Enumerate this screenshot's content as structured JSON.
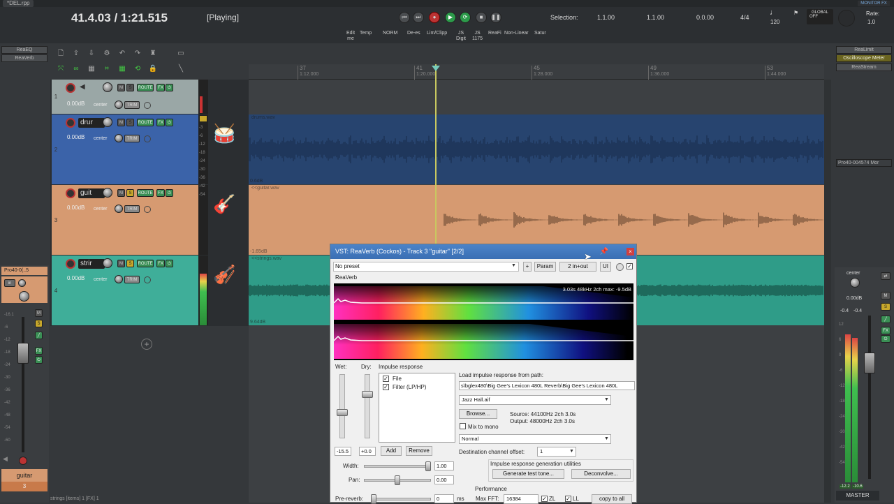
{
  "window": {
    "file_tab": "*DEL.rpp",
    "monitor_badge": "MONITOR FX"
  },
  "transport": {
    "time": "41.4.03 / 1:21.515",
    "state": "[Playing]",
    "selection_label": "Selection:",
    "selection_start": "1.1.00",
    "selection_end": "1.1.00",
    "selection_len": "0.0.00",
    "time_sig": "4/4",
    "bpm": "120",
    "global_label": "GLOBAL",
    "global_state": "OFF",
    "rate_label": "Rate:",
    "rate_value": "1.0",
    "sub_buttons": [
      {
        "l1": "Edit",
        "l2": "me"
      },
      {
        "l1": "Temp",
        "l2": ""
      },
      {
        "l1": "NORM",
        "l2": ""
      },
      {
        "l1": "De-es",
        "l2": ""
      },
      {
        "l1": "Lim/Clipp",
        "l2": ""
      },
      {
        "l1": "JS",
        "l2": "Digit"
      },
      {
        "l1": "JS",
        "l2": "1175"
      },
      {
        "l1": "ReaFi",
        "l2": ""
      },
      {
        "l1": "Non-Linear",
        "l2": ""
      },
      {
        "l1": "Satur",
        "l2": ""
      }
    ]
  },
  "left_fx": [
    "ReaEQ",
    "ReaVerb"
  ],
  "right_fx": [
    "ReaLimit",
    "Oscilloscope Meter",
    "ReaStream"
  ],
  "right_plugin": "Pro40-004574 Mor",
  "ruler": [
    {
      "bar": "37",
      "time": "1:12.000"
    },
    {
      "bar": "41",
      "time": "1:20.000"
    },
    {
      "bar": "45",
      "time": "1:28.000"
    },
    {
      "bar": "49",
      "time": "1:36.000"
    },
    {
      "bar": "53",
      "time": "1:44.000"
    }
  ],
  "tracks": [
    {
      "num": "1",
      "name": "",
      "vol": "0.00dB",
      "pan": "center",
      "color": "#9aa7a6",
      "in": "in"
    },
    {
      "num": "2",
      "name": "drur",
      "vol": "0.00dB",
      "pan": "center",
      "color": "#3b63a9",
      "clip": "drums.wav",
      "clip_db": "0.6dB"
    },
    {
      "num": "3",
      "name": "guit",
      "vol": "0.00dB",
      "pan": "center",
      "color": "#d69a71",
      "clip": "<<guitar.wav",
      "clip_db": "-1.65dB"
    },
    {
      "num": "4",
      "name": "strir",
      "vol": "0.00dB",
      "pan": "center",
      "color": "#3fae99",
      "clip": "<<strings.wav",
      "clip_db": "9.64dB"
    }
  ],
  "track_buttons": {
    "m": "M",
    "s": "S",
    "route": "ROUTE",
    "fx": "FX",
    "trim": "TRIM"
  },
  "meter_scale": [
    "-3",
    "-6",
    "-12",
    "-18",
    "-24",
    "-30",
    "-36",
    "-42",
    "-54"
  ],
  "mixer_left": {
    "plugin": "Pro40-0(..5",
    "track_name": "guitar",
    "track_num": "3",
    "scale": [
      "-16.1",
      "-6",
      "-12",
      "-18",
      "-24",
      "-30",
      "-36",
      "-42",
      "-48",
      "-54",
      "-60"
    ]
  },
  "mixer_right": {
    "pan": "center",
    "vol": "0.00dB",
    "peak_l": "-0.4",
    "peak_r": "-0.4",
    "clip_l": "-12.2",
    "clip_r": "-10.6",
    "label": "MASTER",
    "scale": [
      "12",
      "6",
      "0",
      "-6",
      "-12",
      "-18",
      "-24",
      "-30",
      "-42",
      "-54"
    ]
  },
  "statusbar": "strings [items] 1 [FX] 1",
  "reaverb": {
    "title": "VST: ReaVerb (Cockos) - Track 3 \"guitar\" [2/2]",
    "preset": "No preset",
    "plus": "+",
    "param": "Param",
    "io": "2 in+out",
    "ui": "UI",
    "plugin_name": "ReaVerb",
    "spectrum_info": "3.03s 48kHz 2ch max: -9.5dB",
    "wet_label": "Wet:",
    "dry_label": "Dry:",
    "ir_label": "Impulse response",
    "ir_items": [
      {
        "label": "File",
        "checked": true
      },
      {
        "label": "Filter (LP/HP)",
        "checked": true
      }
    ],
    "wet_value": "-15.5",
    "dry_value": "+0.0",
    "add": "Add",
    "remove": "Remove",
    "load_label": "Load impulse response from path:",
    "path": "s\\bglex480\\Big Gee's Lexicon 480L Reverb\\Big Gee's Lexicon 480L",
    "file": "Jazz Hall.aif",
    "browse": "Browse...",
    "source": "Source: 44100Hz 2ch 3.0s",
    "output": "Output: 48000Hz 2ch 3.0s",
    "mix_mono": "Mix to mono",
    "mode": "Normal",
    "dest_label": "Destination channel offset:",
    "dest_value": "1",
    "width_label": "Width:",
    "width_value": "1.00",
    "width_level": 1.0,
    "pan_label": "Pan:",
    "pan_value": "0.00",
    "pan_level": 0.5,
    "gen_label": "Impulse response generation utilities",
    "gen_tone": "Generate test tone...",
    "deconvolve": "Deconvolve...",
    "perf_label": "Performance",
    "prereverb_label": "Pre-reverb:",
    "prereverb_value": "0",
    "prereverb_unit": "ms",
    "maxfft_label": "Max FFT:",
    "maxfft_value": "16384",
    "zl": "ZL",
    "ll": "LL",
    "copy_all": "copy to all"
  }
}
